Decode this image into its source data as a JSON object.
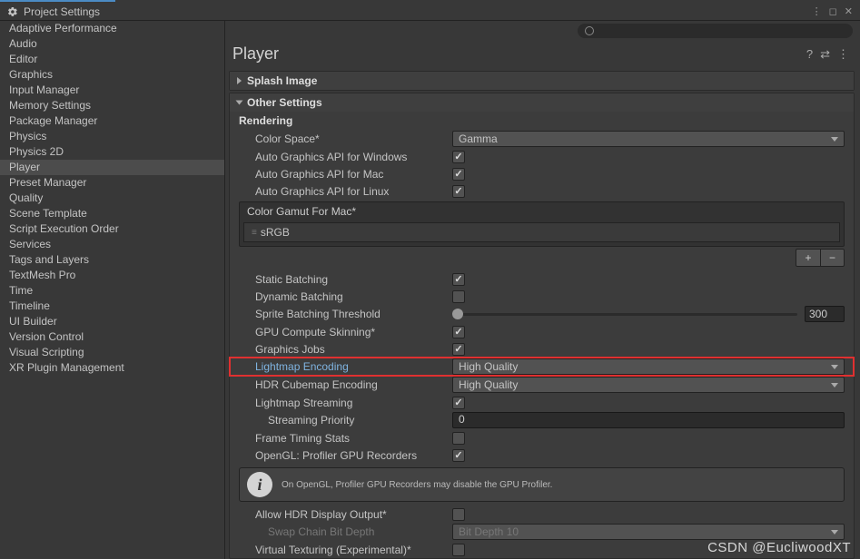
{
  "window": {
    "title": "Project Settings"
  },
  "sidebar": {
    "items": [
      "Adaptive Performance",
      "Audio",
      "Editor",
      "Graphics",
      "Input Manager",
      "Memory Settings",
      "Package Manager",
      "Physics",
      "Physics 2D",
      "Player",
      "Preset Manager",
      "Quality",
      "Scene Template",
      "Script Execution Order",
      "Services",
      "Tags and Layers",
      "TextMesh Pro",
      "Time",
      "Timeline",
      "UI Builder",
      "Version Control",
      "Visual Scripting",
      "XR Plugin Management"
    ],
    "selected_index": 9
  },
  "panel": {
    "title": "Player",
    "sections": {
      "splash": {
        "label": "Splash Image"
      },
      "other": {
        "label": "Other Settings",
        "rendering_label": "Rendering",
        "color_space": {
          "label": "Color Space*",
          "value": "Gamma"
        },
        "auto_gfx_win": {
          "label": "Auto Graphics API  for Windows",
          "checked": true
        },
        "auto_gfx_mac": {
          "label": "Auto Graphics API  for Mac",
          "checked": true
        },
        "auto_gfx_linux": {
          "label": "Auto Graphics API  for Linux",
          "checked": true
        },
        "color_gamut": {
          "label": "Color Gamut For Mac*",
          "items": [
            "sRGB"
          ],
          "add": "+",
          "remove": "−"
        },
        "static_batching": {
          "label": "Static Batching",
          "checked": true
        },
        "dynamic_batching": {
          "label": "Dynamic Batching",
          "checked": false
        },
        "sprite_threshold": {
          "label": "Sprite Batching Threshold",
          "value": "300"
        },
        "gpu_skinning": {
          "label": "GPU Compute Skinning*",
          "checked": true
        },
        "graphics_jobs": {
          "label": "Graphics Jobs",
          "checked": true
        },
        "lightmap_encoding": {
          "label": "Lightmap Encoding",
          "value": "High Quality"
        },
        "hdr_cubemap": {
          "label": "HDR Cubemap Encoding",
          "value": "High Quality"
        },
        "lightmap_streaming": {
          "label": "Lightmap Streaming",
          "checked": true
        },
        "streaming_priority": {
          "label": "Streaming Priority",
          "value": "0"
        },
        "frame_timing": {
          "label": "Frame Timing Stats",
          "checked": false
        },
        "opengl_recorders": {
          "label": "OpenGL: Profiler GPU Recorders",
          "checked": true
        },
        "info_note": "On OpenGL, Profiler GPU Recorders may disable the GPU Profiler.",
        "allow_hdr": {
          "label": "Allow HDR Display Output*",
          "checked": false
        },
        "swap_chain": {
          "label": "Swap Chain Bit Depth",
          "value": "Bit Depth 10"
        },
        "virtual_texturing": {
          "label": "Virtual Texturing (Experimental)*",
          "checked": false
        }
      }
    }
  },
  "watermark": "CSDN @EucliwoodXT"
}
